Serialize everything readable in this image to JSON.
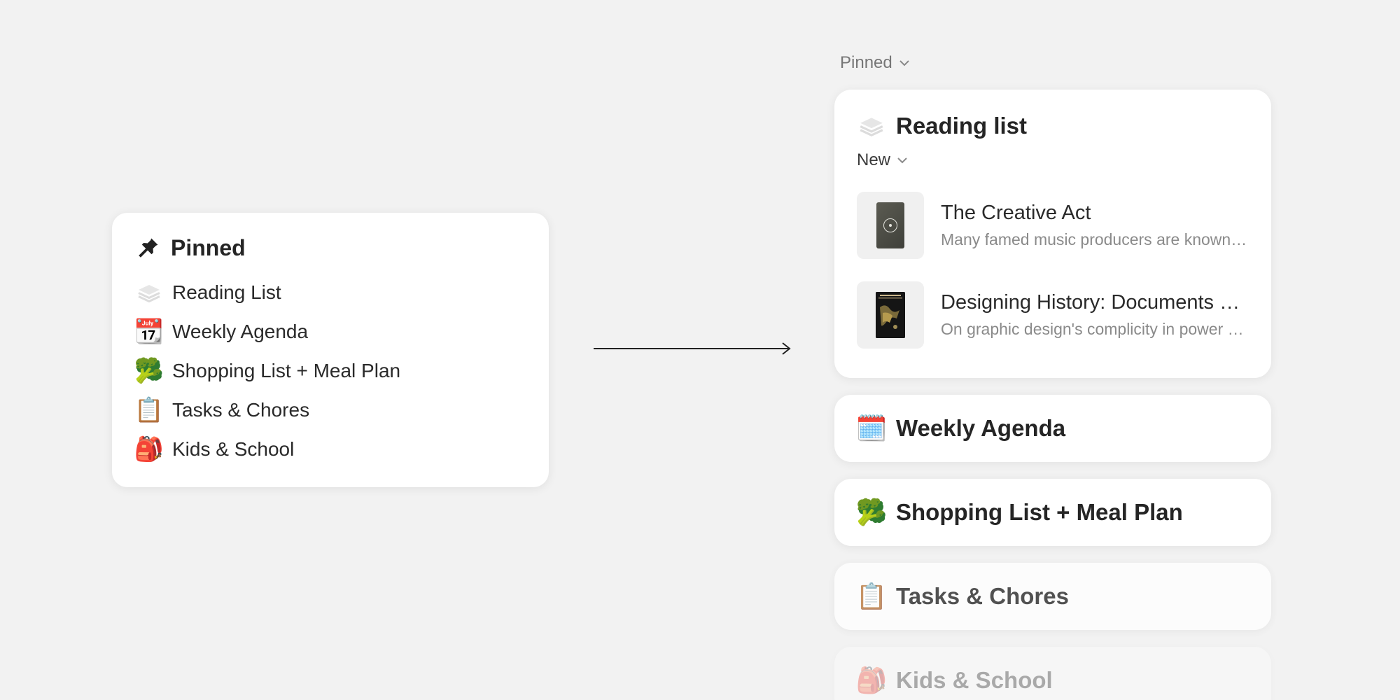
{
  "left_card": {
    "title": "Pinned",
    "items": [
      {
        "label": "Reading List",
        "icon": "stack-icon"
      },
      {
        "label": "Weekly Agenda",
        "icon": "calendar-icon",
        "emoji": "📆"
      },
      {
        "label": "Shopping List + Meal Plan",
        "icon": "broccoli-icon",
        "emoji": "🥦"
      },
      {
        "label": "Tasks & Chores",
        "icon": "clipboard-icon",
        "emoji": "📋"
      },
      {
        "label": "Kids & School",
        "icon": "backpack-icon",
        "emoji": "🎒"
      }
    ]
  },
  "right_panel": {
    "section_label": "Pinned",
    "reading_widget": {
      "title": "Reading list",
      "filter": "New",
      "books": [
        {
          "title": "The Creative Act",
          "description": "Many famed music producers are known for their expertise"
        },
        {
          "title": "Designing History: Documents of Graphic Design",
          "description": "On graphic design's complicity in power structures"
        }
      ]
    },
    "widgets": [
      {
        "title": "Weekly Agenda",
        "emoji": "🗓️"
      },
      {
        "title": "Shopping List + Meal Plan",
        "emoji": "🥦"
      },
      {
        "title": "Tasks & Chores",
        "emoji": "📋"
      },
      {
        "title": "Kids & School",
        "emoji": "🎒"
      }
    ]
  }
}
